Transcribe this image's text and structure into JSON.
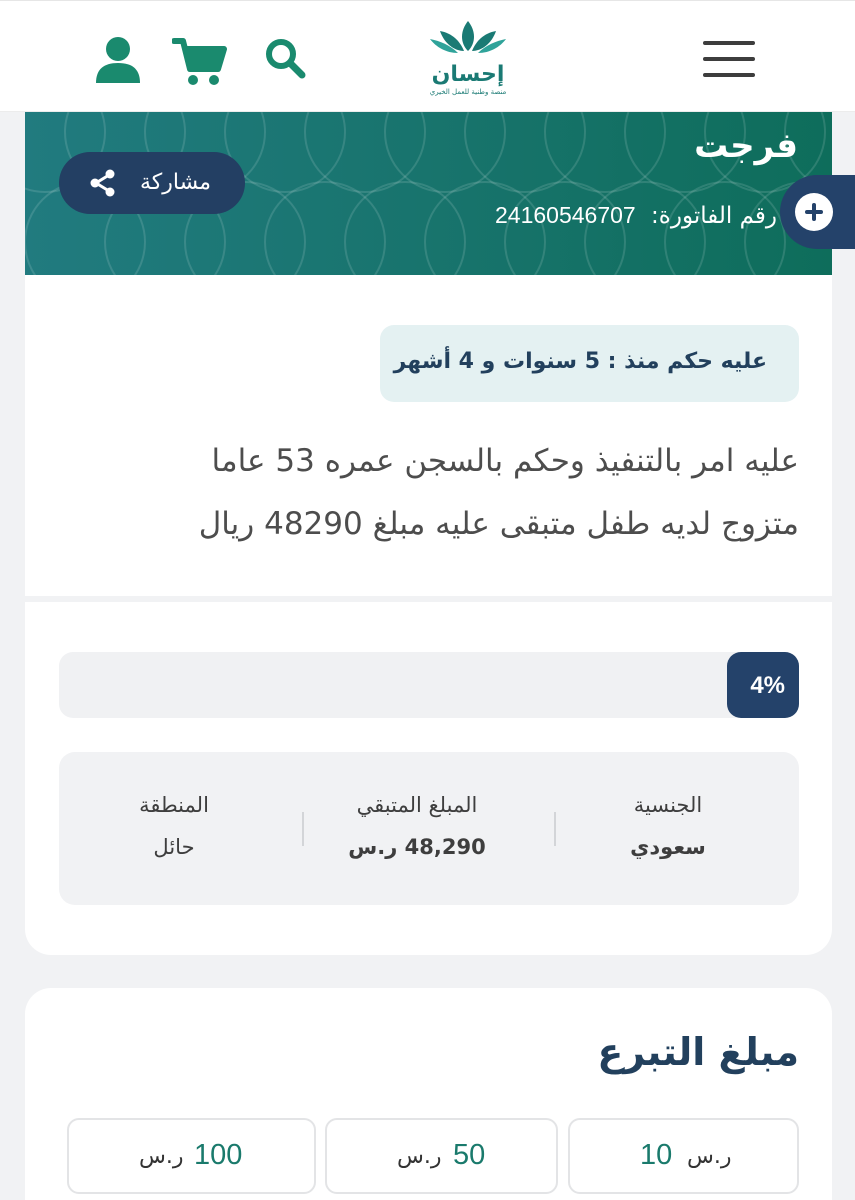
{
  "header": {
    "logo_text": "إحسان",
    "logo_tagline": "منصة وطنية للعمل الخيري"
  },
  "case": {
    "title": "فرجت",
    "invoice_label": "رقم الفاتورة:",
    "invoice_number": "24160546707",
    "share_label": "مشاركة",
    "sentence_badge": "عليه حكم منذ : 5 سنوات و 4 أشهر",
    "description_line1": "عليه امر بالتنفيذ وحكم بالسجن عمره 53 عاما",
    "description_line2": "متزوج لديه طفل متبقى عليه مبلغ 48290 ريال",
    "progress": {
      "label": "4%",
      "value": 4
    },
    "info": {
      "nationality_label": "الجنسية",
      "nationality_value": "سعودي",
      "remaining_label": "المبلغ المتبقي",
      "remaining_value": "48,290 ر.س",
      "region_label": "المنطقة",
      "region_value": "حائل"
    }
  },
  "donation": {
    "title": "مبلغ التبرع",
    "amounts": [
      {
        "value": "10",
        "currency": "ر.س"
      },
      {
        "value": "50",
        "currency": "ر.س"
      },
      {
        "value": "100",
        "currency": "ر.س"
      }
    ]
  },
  "colors": {
    "brand_teal": "#17736b",
    "navy": "#24426a",
    "badge_bg": "#e4f1f2",
    "amount_green": "#1a7a6c"
  },
  "icons": {
    "menu": "hamburger-icon",
    "search": "search-icon",
    "cart": "cart-icon",
    "user": "user-icon",
    "share": "share-icon",
    "fab": "plus-icon"
  }
}
